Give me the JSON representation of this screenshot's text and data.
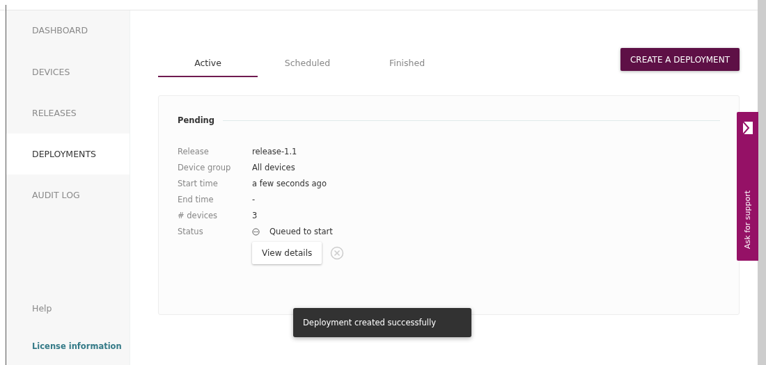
{
  "sidebar": {
    "items": [
      {
        "label": "DASHBOARD",
        "selected": false
      },
      {
        "label": "DEVICES",
        "selected": false
      },
      {
        "label": "RELEASES",
        "selected": false
      },
      {
        "label": "DEPLOYMENTS",
        "selected": true
      },
      {
        "label": "AUDIT LOG",
        "selected": false
      }
    ],
    "help": "Help",
    "license": "License information"
  },
  "tabs": [
    {
      "label": "Active",
      "selected": true
    },
    {
      "label": "Scheduled",
      "selected": false
    },
    {
      "label": "Finished",
      "selected": false
    }
  ],
  "create_button": "CREATE A DEPLOYMENT",
  "card": {
    "section": "Pending",
    "fields": [
      {
        "label": "Release",
        "value": "release-1.1"
      },
      {
        "label": "Device group",
        "value": "All devices"
      },
      {
        "label": "Start time",
        "value": "a few seconds ago"
      },
      {
        "label": "End time",
        "value": "-"
      },
      {
        "label": "# devices",
        "value": "3"
      },
      {
        "label": "Status",
        "value": "Queued to start",
        "kind": "status"
      }
    ],
    "details_button": "View details"
  },
  "toast": "Deployment created successfully",
  "support_tab": "Ask for support"
}
